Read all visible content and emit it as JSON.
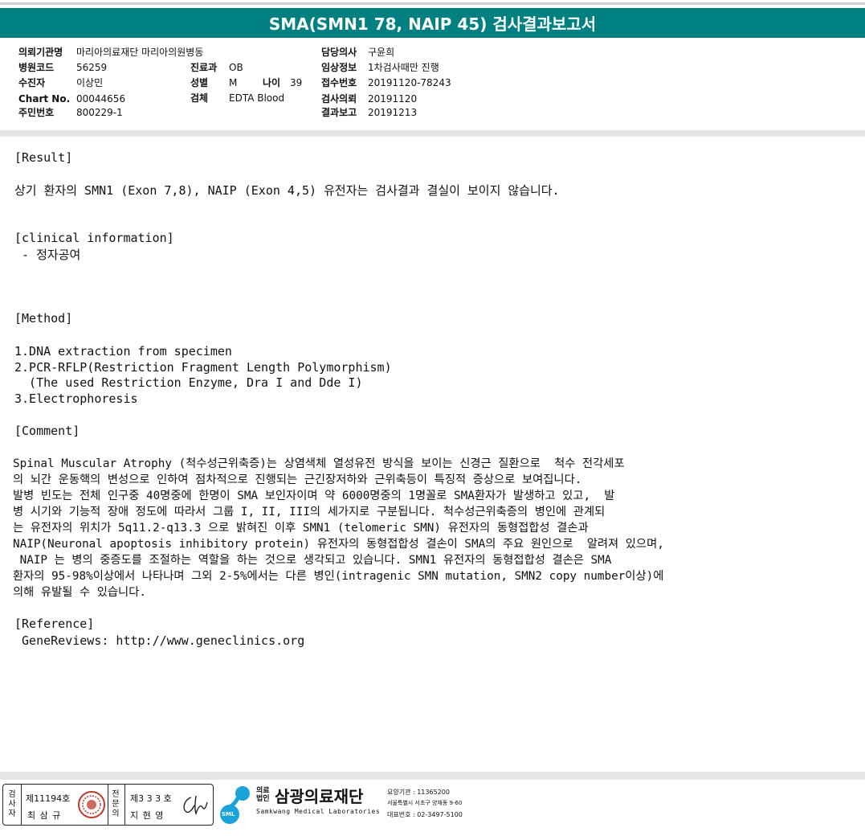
{
  "title": "SMA(SMN1 78, NAIP 45) 검사결과보고서",
  "header": {
    "left": [
      {
        "label": "의뢰기관명",
        "value": "마리아의료재단 마리아의원병동"
      },
      {
        "label": "병원코드",
        "value": "56259"
      },
      {
        "label": "수진자",
        "value": "이상민"
      },
      {
        "label": "Chart No.",
        "value": "00044656"
      },
      {
        "label": "주민번호",
        "value": "800229-1"
      }
    ],
    "middle": [
      {
        "label": "진료과",
        "value": "OB"
      },
      {
        "label": "성별",
        "value": "M"
      },
      {
        "label": "검체",
        "value": "EDTA Blood"
      }
    ],
    "age": {
      "label": "나이",
      "value": "39"
    },
    "right": [
      {
        "label": "담당의사",
        "value": "구윤희"
      },
      {
        "label": "임상정보",
        "value": "1차검사때만 진행"
      },
      {
        "label": "접수번호",
        "value": "20191120-78243"
      },
      {
        "label": "검사의뢰",
        "value": "20191120"
      },
      {
        "label": "결과보고",
        "value": "20191213"
      }
    ]
  },
  "body": {
    "result_heading": "[Result]",
    "result_text": "상기 환자의 SMN1 (Exon 7,8), NAIP (Exon 4,5) 유전자는 검사결과 결실이 보이지 않습니다.",
    "clinical_heading": "[clinical information]",
    "clinical_text": " - 정자공여",
    "method_heading": "[Method]",
    "method_lines": [
      "1.DNA extraction from specimen",
      "2.PCR-RFLP(Restriction Fragment Length Polymorphism)",
      "  (The used Restriction Enzyme, Dra I and Dde I)",
      "3.Electrophoresis"
    ],
    "comment_heading": "[Comment]",
    "comment_lines": [
      "Spinal Muscular Atrophy (척수성근위축증)는 상염색체 열성유전 방식을 보이는 신경근 질환으로  척수 전각세포",
      "의 뇌간 운동핵의 변성으로 인하여 점차적으로 진행되는 근긴장저하와 근위축등이 특징적 증상으로 보여집니다.",
      "발병 빈도는 전체 인구중 40명중에 한명이 SMA 보인자이며 약 6000명중의 1명꼴로 SMA환자가 발생하고 있고,  발",
      "병 시기와 기능적 장애 정도에 따라서 그룹 I, II, III의 세가지로 구분됩니다. 척수성근위축증의 병인에 관계되",
      "는 유전자의 위치가 5q11.2-q13.3 으로 밝혀진 이후 SMN1 (telomeric SMN) 유전자의 동형접합성 결손과",
      "NAIP(Neuronal apoptosis inhibitory protein) 유전자의 동형접합성 결손이 SMA의 주요 원인으로  알려져 있으며,",
      " NAIP 는 병의 중증도를 조절하는 역할을 하는 것으로 생각되고 있습니다. SMN1 유전자의 동형접합성 결손은 SMA",
      "환자의 95-98%이상에서 나타나며 그외 2-5%에서는 다른 병인(intragenic SMN mutation, SMN2 copy number이상)에",
      "의해 유발될 수 있습니다."
    ],
    "reference_heading": "[Reference]",
    "reference_text": " GeneReviews: http://www.geneclinics.org"
  },
  "footer": {
    "sig1_vertical": [
      "검",
      "사",
      "자"
    ],
    "sig1_license": "제11194호",
    "sig1_name": "최 삼 규",
    "sig2_vertical": [
      "전",
      "문",
      "의"
    ],
    "sig2_license": "제3 3 3 호",
    "sig2_name": "지 현 영",
    "logo_badge": "SML",
    "logo_prefix": "의료\n법인",
    "org_name": "삼광의료재단",
    "org_english": "Samkwang Medical Laboratories",
    "org_code": "요양기관 : 11365200",
    "org_address": "서울특별시 서초구 양재동 9-60",
    "org_phone": "대표번호 : 02-3497-5100",
    "colors": {
      "brand": "#008080",
      "logo_blue": "#1aa3d9",
      "seal_red": "#c0392b"
    }
  }
}
